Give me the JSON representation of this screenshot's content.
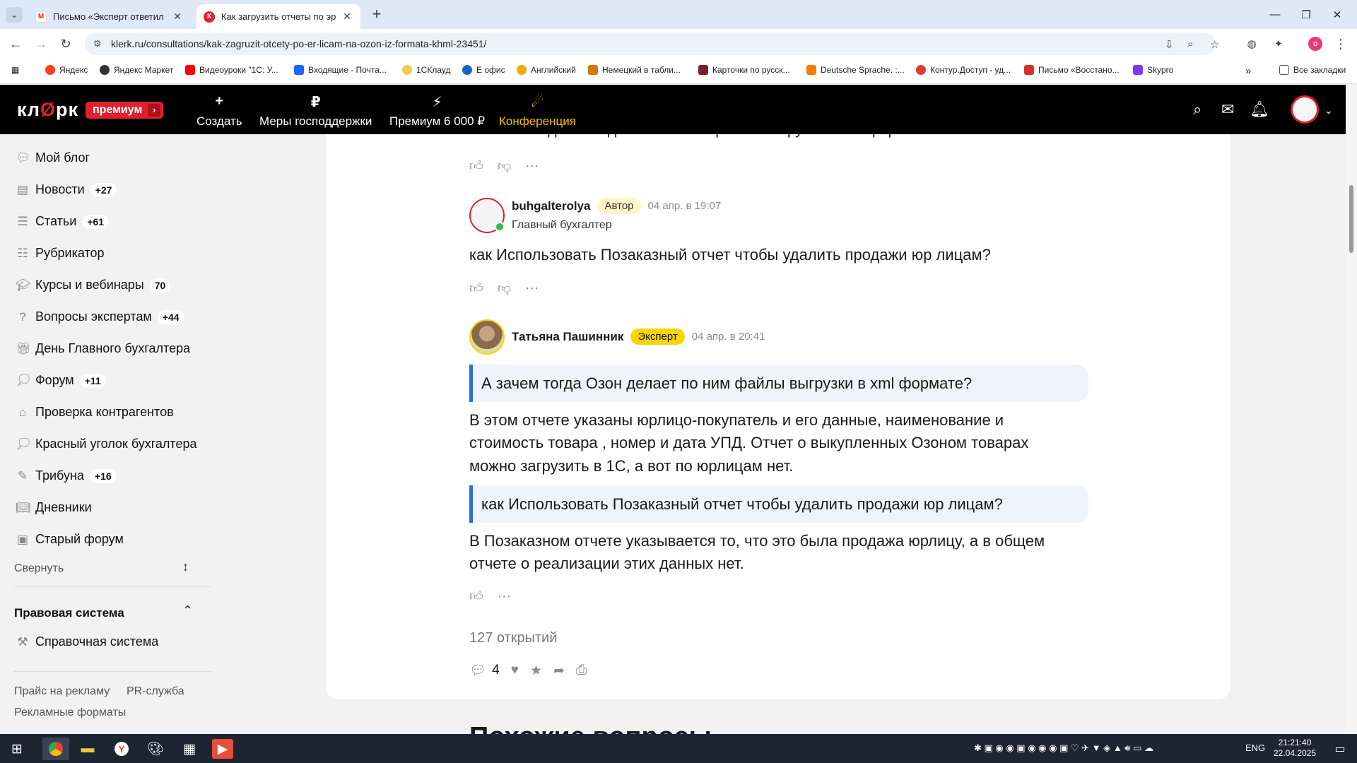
{
  "browser": {
    "tabs": [
      {
        "title": "Письмо «Эксперт ответил на в",
        "icon": "gmail-icon"
      },
      {
        "title": "Как загрузить отчеты по эр ли",
        "icon": "klerk-icon"
      }
    ],
    "url": "klerk.ru/consultations/kak-zagruzit-otcety-po-er-licam-na-ozon-iz-formata-khml-23451/",
    "bookmarks": [
      "Яндекс",
      "Яндекс Маркет",
      "Видеоуроки \"1С: У...",
      "Входящие - Почта...",
      "1СКлауд",
      "Е офис",
      "Английский",
      "Немецкий в табли...",
      "Карточки по русск...",
      "Deutsche Sprache. :...",
      "Контур.Доступ - уд...",
      "Письмо «Восстано...",
      "Skypro"
    ],
    "all_bookmarks": "Все закладки",
    "profile_initial": "o"
  },
  "site": {
    "logo": "кл рк",
    "premium": "премиум",
    "nav": [
      "Создать",
      "Меры господдержки",
      "Премиум 6 000 ₽",
      "Конференция"
    ],
    "nav_icons": [
      "+",
      "₽",
      "⚡",
      "☄"
    ]
  },
  "sidebar": {
    "items": [
      {
        "label": "Мой блог",
        "count": ""
      },
      {
        "label": "Новости",
        "count": "+27"
      },
      {
        "label": "Статьи",
        "count": "+61"
      },
      {
        "label": "Рубрикатор",
        "count": ""
      },
      {
        "label": "Курсы и вебинары",
        "count": "70"
      },
      {
        "label": "Вопросы экспертам",
        "count": "+44"
      },
      {
        "label": "День Главного бухгалтера",
        "count": ""
      },
      {
        "label": "Форум",
        "count": "+11"
      },
      {
        "label": "Проверка контрагентов",
        "count": ""
      },
      {
        "label": "Красный уголок бухгалтера",
        "count": ""
      },
      {
        "label": "Трибуна",
        "count": "+16"
      },
      {
        "label": "Дневники",
        "count": ""
      },
      {
        "label": "Старый форум",
        "count": ""
      }
    ],
    "collapse": "Свернуть",
    "legal_title": "Правовая система",
    "legal_items": [
      "Справочная система"
    ],
    "footer": [
      "Прайс на рекламу",
      "PR-служба",
      "Рекламные форматы"
    ]
  },
  "comments": {
    "cut_text": "А зачем тогда Озон делает по ним файлы выгрузки в xml формате?",
    "c1": {
      "user": "buhgalterolya",
      "tag": "Автор",
      "time": "04 апр. в 19:07",
      "role": "Главный бухгалтер",
      "text": "как Использовать Позаказный отчет чтобы удалить продажи юр лицам?"
    },
    "c2": {
      "user": "Татьяна Пашинник",
      "tag": "Эксперт",
      "time": "04 апр. в 20:41",
      "quote1": "А зачем тогда Озон делает по ним файлы выгрузки в xml формате?",
      "text1_l1": "В этом отчете указаны юрлицо-покупатель и его данные, наименование и",
      "text1_l2": "стоимость товара , номер и дата УПД. Отчет о выкупленных Озоном товарах",
      "text1_l3": "можно загрузить в 1С, а вот по юрлицам нет.",
      "quote2": "как Использовать Позаказный отчет чтобы удалить продажи юр лицам?",
      "text2_l1": "В Позаказном отчете указывается то, что это была продажа юрлицу, а в общем",
      "text2_l2": "отчете о реализации этих данных нет."
    }
  },
  "stats": {
    "opens": "127 открытий",
    "comments_count": "4"
  },
  "similar_title": "Похожие вопросы",
  "taskbar": {
    "lang": "ENG",
    "time": "21:21:40",
    "date": "22.04.2025"
  },
  "colors": {
    "accent": "#e1202e",
    "gold": "#f3c100",
    "quote": "#2d6ee0"
  }
}
